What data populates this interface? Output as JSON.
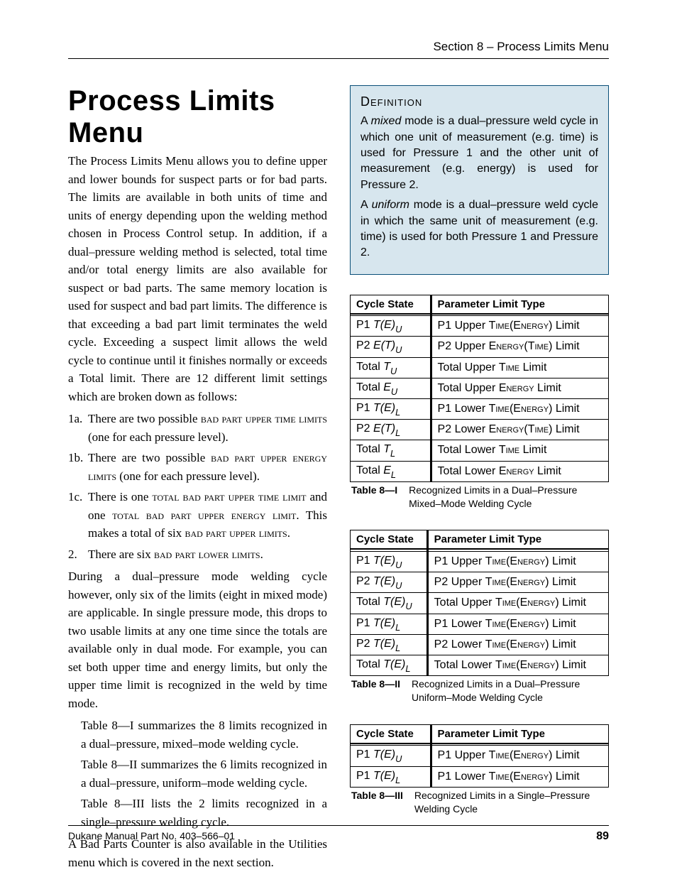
{
  "runningHead": "Section 8 – Process Limits Menu",
  "title": "Process Limits Menu",
  "intro": "The Process Limits Menu allows you to define upper and lower bounds for suspect parts or for bad parts. The limits are available in both units of time and units of energy depending upon the welding method chosen in Process Control setup. In addition, if a dual–pressure welding method is selected, total time and/or total energy limits are also available for suspect or bad parts. The same memory location is used for suspect and bad part limits. The difference is that exceeding a bad part limit terminates the weld cycle. Exceeding a suspect limit allows the weld cycle to continue until it finishes normally or exceeds a Total limit. There are 12 different limit settings which are broken down as follows:",
  "list": [
    {
      "num": "1a.",
      "pre": "There are two possible ",
      "sc": "bad part upper time limits",
      "post": " (one for each pressure level)."
    },
    {
      "num": "1b.",
      "pre": "There are two possible ",
      "sc": "bad part upper energy limits",
      "post": " (one for each pressure level)."
    },
    {
      "num": "1c.",
      "pre": "There is one ",
      "sc": "total bad part upper time limit",
      "post2pre": " and one ",
      "sc2": "total bad part upper energy limit",
      "post2": ". This makes a total of six ",
      "sc3": "bad part upper limits",
      "post3": "."
    },
    {
      "num": "2.",
      "pre": "There are six ",
      "sc": "bad part lower limits",
      "post": "."
    }
  ],
  "midpara": "During a dual–pressure mode welding cycle however, only six of the limits (eight in mixed mode) are applicable. In single pressure mode, this drops to two usable limits at any one time since the totals are available only in dual mode. For example, you can set both upper time and energy limits, but only the upper time limit is recognized in the weld by time mode.",
  "tableRefs": [
    "Table 8—I summarizes the 8 limits recognized in a dual–pressure, mixed–mode welding cycle.",
    "Table 8—II summarizes the 6 limits recognized in a dual–pressure, uniform–mode welding cycle.",
    "Table 8—III lists the 2 limits recognized in a single–pressure welding cycle."
  ],
  "badCounter": "A Bad Parts Counter is also available in the Utilities menu which is covered in the next section.",
  "definition": {
    "head": "Definition",
    "mixed": {
      "lead": "A ",
      "em": "mixed",
      "rest": " mode is a dual–pressure weld cycle in which one unit of measurement (e.g. time) is used for Pressure 1 and the other unit of measurement (e.g. energy) is used for Pressure 2."
    },
    "uniform": {
      "lead": "A ",
      "em": "uniform",
      "rest": " mode is a dual–pressure weld cycle in which the same unit of measurement (e.g. time) is used for both Pressure 1 and Pressure 2."
    }
  },
  "tables": {
    "headers": {
      "cycle": "Cycle State",
      "ptype": "Parameter Limit Type"
    },
    "t1": {
      "rows": [
        {
          "csPre": "P1 ",
          "csTag": "T(E)",
          "csSub": "U",
          "pt": "P1 Upper Time(Energy) Limit"
        },
        {
          "csPre": "P2 ",
          "csTag": "E(T)",
          "csSub": "U",
          "pt": "P2 Upper Energy(Time) Limit"
        },
        {
          "csPre": "Total ",
          "csTag": "T",
          "csSub": "U",
          "pt": "Total Upper Time Limit"
        },
        {
          "csPre": "Total ",
          "csTag": "E",
          "csSub": "U",
          "pt": "Total Upper Energy Limit"
        },
        {
          "csPre": "P1 ",
          "csTag": "T(E)",
          "csSub": "L",
          "pt": "P1 Lower Time(Energy) Limit"
        },
        {
          "csPre": "P2 ",
          "csTag": "E(T)",
          "csSub": "L",
          "pt": "P2 Lower Energy(Time) Limit"
        },
        {
          "csPre": "Total ",
          "csTag": "T",
          "csSub": "L",
          "pt": "Total Lower Time Limit"
        },
        {
          "csPre": "Total ",
          "csTag": "E",
          "csSub": "L",
          "pt": "Total Lower Energy Limit"
        }
      ],
      "capNum": "Table 8—I",
      "capText": "Recognized Limits in a Dual–Pressure Mixed–Mode Welding Cycle"
    },
    "t2": {
      "rows": [
        {
          "csPre": "P1 ",
          "csTag": "T(E)",
          "csSub": "U",
          "pt": "P1 Upper Time(Energy) Limit"
        },
        {
          "csPre": "P2 ",
          "csTag": "T(E)",
          "csSub": "U",
          "pt": "P2 Upper Time(Energy) Limit"
        },
        {
          "csPre": "Total ",
          "csTag": "T(E)",
          "csSub": "U",
          "pt": "Total Upper Time(Energy) Limit"
        },
        {
          "csPre": "P1 ",
          "csTag": "T(E)",
          "csSub": "L",
          "pt": "P1 Lower Time(Energy) Limit"
        },
        {
          "csPre": "P2 ",
          "csTag": "T(E)",
          "csSub": "L",
          "pt": "P2 Lower Time(Energy) Limit"
        },
        {
          "csPre": "Total ",
          "csTag": "T(E)",
          "csSub": "L",
          "pt": "Total Lower Time(Energy) Limit"
        }
      ],
      "capNum": "Table 8—II",
      "capText": "Recognized Limits in a Dual–Pressure Uniform–Mode Welding Cycle"
    },
    "t3": {
      "rows": [
        {
          "csPre": "P1 ",
          "csTag": "T(E)",
          "csSub": "U",
          "pt": "P1 Upper Time(Energy) Limit"
        },
        {
          "csPre": "P1 ",
          "csTag": "T(E)",
          "csSub": "L",
          "pt": "P1 Lower Time(Energy) Limit"
        }
      ],
      "capNum": "Table 8—III",
      "capText": "Recognized Limits in a Single–Pressure Welding Cycle"
    }
  },
  "footer": {
    "left": "Dukane Manual Part No. 403–566–01",
    "page": "89"
  }
}
